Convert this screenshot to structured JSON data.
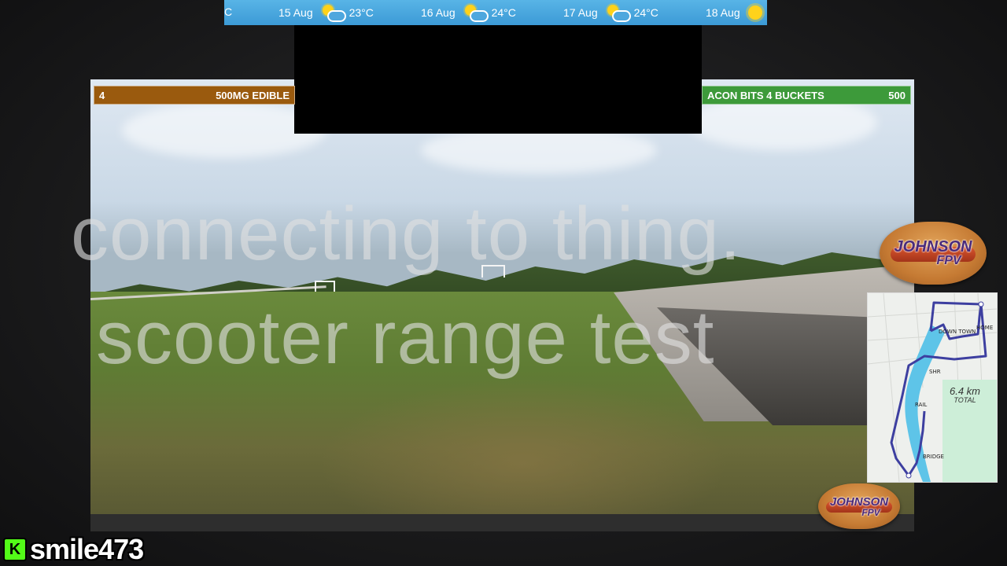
{
  "weather": {
    "lead_fragment": "C",
    "days": [
      {
        "date": "15 Aug",
        "icon": "partly-cloudy-icon",
        "temp": "23°C"
      },
      {
        "date": "16 Aug",
        "icon": "partly-cloudy-icon",
        "temp": "24°C"
      },
      {
        "date": "17 Aug",
        "icon": "partly-cloudy-icon",
        "temp": "24°C"
      },
      {
        "date": "18 Aug",
        "icon": "sun-icon",
        "temp": ""
      }
    ]
  },
  "alerts": {
    "left": {
      "number": "4",
      "label": "500MG EDIBLE",
      "color": "#9a5a0e"
    },
    "right": {
      "label": "ACON BITS 4 BUCKETS",
      "number": "500",
      "color": "#3d9a3a"
    }
  },
  "overlay": {
    "line1": "connecting to thing.",
    "line2": "scooter range test"
  },
  "logos": {
    "big": {
      "line1": "JOHNSON",
      "line2": "FPV"
    },
    "small": {
      "line1": "JOHNSON",
      "line2": "FPV"
    }
  },
  "map": {
    "labels": {
      "downtown": "DOWN TOWN",
      "home": "HOME",
      "bikeshare": "SHR",
      "trail": "RAIL",
      "bridge": "BRIDGE"
    },
    "total_distance": "6.4 km",
    "total_label": "TOTAL"
  },
  "user": {
    "platform_icon": "K",
    "username": "smile473"
  }
}
